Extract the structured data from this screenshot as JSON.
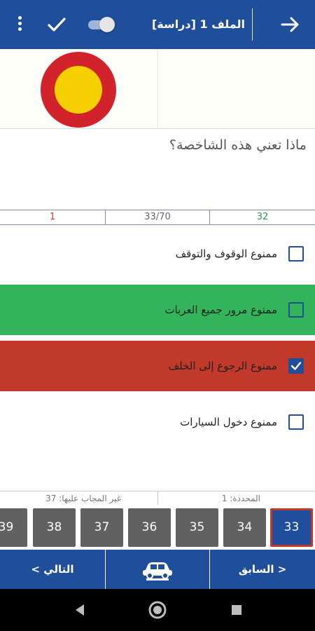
{
  "topbar": {
    "title": "الملف 1 [دراسة]",
    "icons": [
      "more-vert-icon",
      "check-icon",
      "toggle-switch",
      "arrow-forward-icon"
    ]
  },
  "question": {
    "text": "ماذا تعني هذه الشاخصة؟",
    "sign_colors": {
      "ring": "#d2232a",
      "center": "#f6d000"
    }
  },
  "counters": {
    "wrong": "1",
    "progress": "33/70",
    "correct": "32"
  },
  "options": [
    {
      "label": "ممنوع الوقوف والتوقف",
      "checked": false,
      "state": "none"
    },
    {
      "label": "ممنوع مرور جميع العربات",
      "checked": false,
      "state": "correct"
    },
    {
      "label": "ممنوع الرجوع إلى الخلف",
      "checked": true,
      "state": "wrong"
    },
    {
      "label": "ممنوع دخول السيارات",
      "checked": false,
      "state": "none"
    }
  ],
  "stats": {
    "selected": "المحددة: 1",
    "unanswered": "غير المجاب عليها: 37"
  },
  "numbers": [
    "39",
    "38",
    "37",
    "36",
    "35",
    "34",
    "33"
  ],
  "active_number": "33",
  "bottomnav": {
    "next": "التالي >",
    "prev": "< السابق",
    "center_icon": "car-icon"
  },
  "colors": {
    "primary": "#1f4e9b",
    "correct": "#34b45a",
    "wrong": "#c0392b",
    "tile": "#616161"
  }
}
